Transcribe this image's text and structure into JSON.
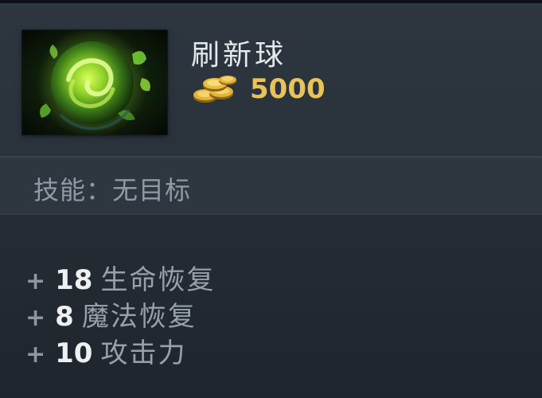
{
  "item": {
    "name": "刷新球",
    "icon": "refresher-orb-icon",
    "cost": "5000"
  },
  "ability": {
    "text": "技能：无目标"
  },
  "stats": [
    {
      "plus": "+",
      "value": "18",
      "label": "生命恢复"
    },
    {
      "plus": "+",
      "value": "8",
      "label": "魔法恢复"
    },
    {
      "plus": "+",
      "value": "10",
      "label": "攻击力"
    }
  ],
  "colors": {
    "gold": "#e8c35a",
    "name": "#e6e9ec",
    "muted": "#97a1ab",
    "background": "#28313a"
  }
}
